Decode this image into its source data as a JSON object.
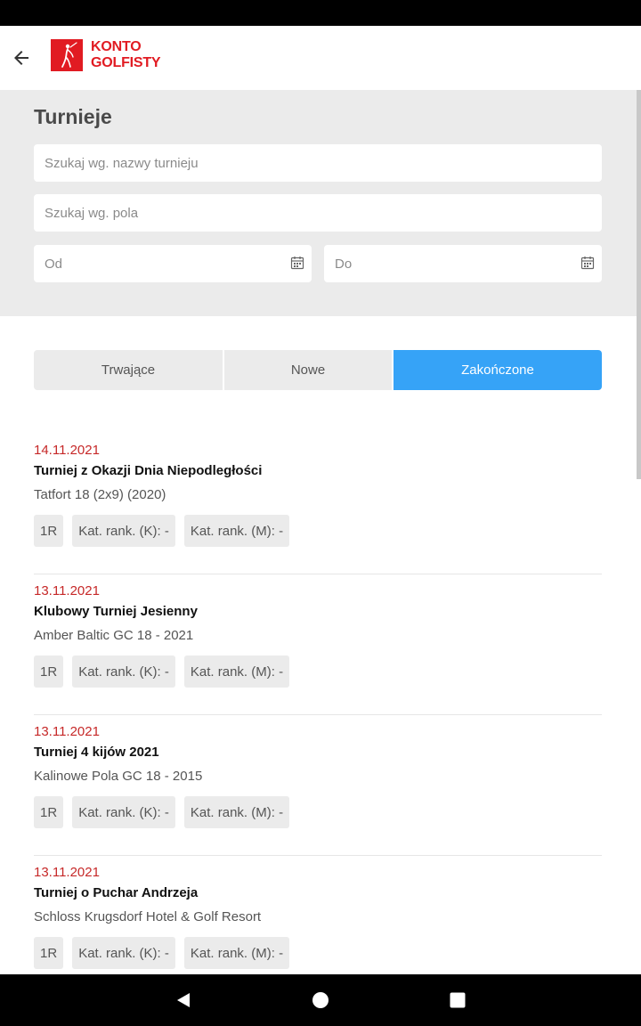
{
  "app": {
    "logo_line1": "KONTO",
    "logo_line2": "GOLFISTY",
    "brand_color": "#e11b22"
  },
  "search": {
    "title": "Turnieje",
    "name_placeholder": "Szukaj wg. nazwy turnieju",
    "course_placeholder": "Szukaj wg. pola",
    "from_placeholder": "Od",
    "to_placeholder": "Do"
  },
  "tabs": [
    {
      "label": "Trwające",
      "active": false
    },
    {
      "label": "Nowe",
      "active": false
    },
    {
      "label": "Zakończone",
      "active": true
    }
  ],
  "accent_color": "#36a3f7",
  "date_color": "#c62828",
  "tournaments": [
    {
      "date": "14.11.2021",
      "name": "Turniej z Okazji Dnia Niepodległości",
      "course": "Tatfort 18 (2x9) (2020)",
      "rounds": "1R",
      "rank_k": "Kat. rank. (K): -",
      "rank_m": "Kat. rank. (M): -"
    },
    {
      "date": "13.11.2021",
      "name": "Klubowy Turniej Jesienny",
      "course": "Amber Baltic GC 18 - 2021",
      "rounds": "1R",
      "rank_k": "Kat. rank. (K): -",
      "rank_m": "Kat. rank. (M): -"
    },
    {
      "date": "13.11.2021",
      "name": "Turniej 4 kijów 2021",
      "course": "Kalinowe Pola GC 18 - 2015",
      "rounds": "1R",
      "rank_k": "Kat. rank. (K): -",
      "rank_m": "Kat. rank. (M): -"
    },
    {
      "date": "13.11.2021",
      "name": "Turniej o Puchar Andrzeja",
      "course": "Schloss Krugsdorf Hotel & Golf Resort",
      "rounds": "1R",
      "rank_k": "Kat. rank. (K): -",
      "rank_m": "Kat. rank. (M): -"
    }
  ],
  "icons": {
    "back": "arrow-left-icon",
    "calendar": "calendar-icon",
    "nav_back": "triangle-back-icon",
    "nav_home": "circle-home-icon",
    "nav_recents": "square-recents-icon"
  }
}
